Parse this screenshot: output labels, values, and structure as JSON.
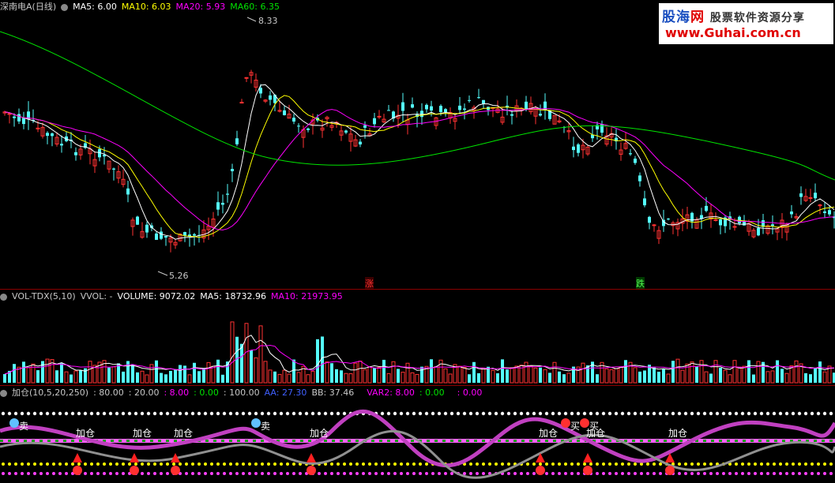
{
  "logo": {
    "brand_a": "股海",
    "brand_b": "网",
    "slogan": "股票软件资源分享",
    "url": "www.Guhai.com.cn"
  },
  "price_header": {
    "stock": "深南电A(日线)",
    "ma5": "MA5: 6.00",
    "ma10": "MA10: 6.03",
    "ma20": "MA20: 5.93",
    "ma60": "MA60: 6.35"
  },
  "price_labels": {
    "high": "8.33",
    "low": "5.26",
    "zhang": "涨",
    "die": "跌"
  },
  "vol_header": {
    "name": "VOL-TDX(5,10)",
    "vvol": "VVOL: -",
    "volume": "VOLUME: 9072.02",
    "ma5": "MA5: 18732.96",
    "ma10": "MA10: 21973.95"
  },
  "ind_header": {
    "name": "加仓(10,5,20,250)",
    "v1": ": 80.00",
    "v2": ": 20.00",
    "v3": ": 8.00",
    "v4": ": 0.00",
    "v5": ": 100.00",
    "aa": "AA: 27.30",
    "bb": "BB: 37.46",
    "var2": "VAR2: 8.00",
    "v6": ": 0.00",
    "v7": ": 0.00"
  },
  "signals": {
    "jiacang": [
      "加仓",
      "加仓",
      "加仓",
      "加仓",
      "加仓",
      "加仓",
      "加仓"
    ],
    "mai_labels": [
      "卖",
      "卖",
      "买",
      "买"
    ]
  },
  "colors": {
    "up": "#ff3232",
    "down": "#54fcfc",
    "ma5": "#ffffff",
    "ma10": "#ffff00",
    "ma20": "#ff00ff",
    "ma60": "#00e400",
    "sep": "#8b0000"
  }
}
